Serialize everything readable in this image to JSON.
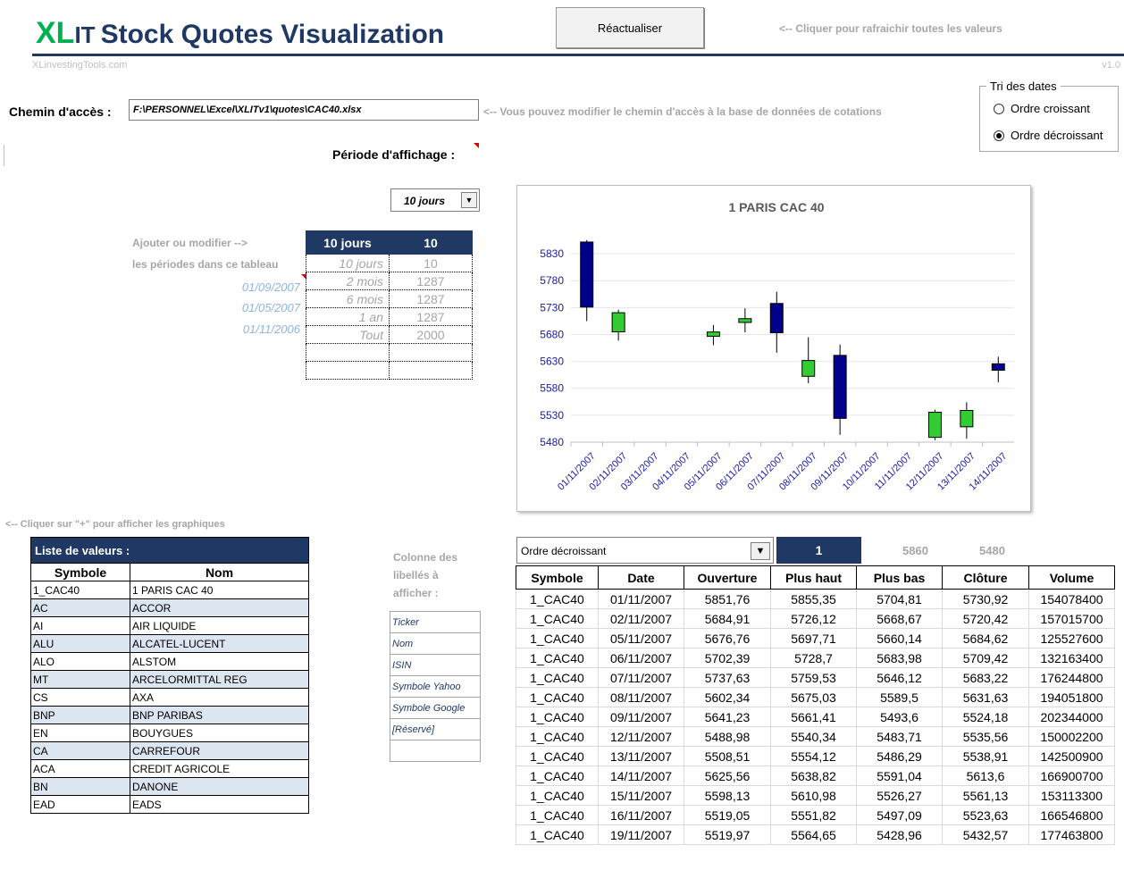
{
  "header": {
    "brand_xl": "XL",
    "brand_it": "IT",
    "brand_rest": "Stock Quotes Visualization",
    "site": "XLinvestingTools.com",
    "version": "v1.0",
    "refresh_label": "Réactualiser",
    "refresh_hint": "<-- Cliquer pour rafraichir toutes les valeurs"
  },
  "path": {
    "label": "Chemin d'accès :",
    "value": "F:\\PERSONNEL\\Excel\\XLITv1\\quotes\\CAC40.xlsx",
    "hint": "<-- Vous pouvez modifier le chemin d'accès à la base de données de cotations"
  },
  "sort": {
    "legend": "Tri des dates",
    "options": [
      "Ordre croissant",
      "Ordre décroissant"
    ],
    "selected": "Ordre décroissant"
  },
  "period": {
    "label": "Période d'affichage :",
    "selected": "10 jours",
    "hint_line1": "Ajouter ou modifier -->",
    "hint_line2": "les périodes dans ce tableau",
    "header": [
      "10 jours",
      "10"
    ],
    "rows": [
      {
        "date": "",
        "name": "10 jours",
        "value": "10"
      },
      {
        "date": "01/09/2007",
        "name": "2 mois",
        "value": "1287"
      },
      {
        "date": "01/05/2007",
        "name": "6 mois",
        "value": "1287"
      },
      {
        "date": "01/11/2006",
        "name": "1 an",
        "value": "1287"
      },
      {
        "date": "",
        "name": "Tout",
        "value": "2000"
      },
      {
        "date": "",
        "name": "",
        "value": ""
      },
      {
        "date": "",
        "name": "",
        "value": ""
      }
    ]
  },
  "chart_data": {
    "type": "candlestick",
    "title": "1 PARIS CAC 40",
    "ylim": [
      5480,
      5860
    ],
    "yticks": [
      5480,
      5530,
      5580,
      5630,
      5680,
      5730,
      5780,
      5830
    ],
    "categories": [
      "01/11/2007",
      "02/11/2007",
      "03/11/2007",
      "04/11/2007",
      "05/11/2007",
      "06/11/2007",
      "07/11/2007",
      "08/11/2007",
      "09/11/2007",
      "10/11/2007",
      "11/11/2007",
      "12/11/2007",
      "13/11/2007",
      "14/11/2007"
    ],
    "open": [
      5851.76,
      5684.91,
      null,
      null,
      5676.76,
      5702.39,
      5737.63,
      5602.34,
      5641.23,
      null,
      null,
      5488.98,
      5508.51,
      5625.56
    ],
    "high": [
      5855.35,
      5726.12,
      null,
      null,
      5697.71,
      5728.7,
      5759.53,
      5675.03,
      5661.41,
      null,
      null,
      5540.34,
      5554.12,
      5638.82
    ],
    "low": [
      5704.81,
      5668.67,
      null,
      null,
      5660.14,
      5683.98,
      5646.12,
      5589.5,
      5493.6,
      null,
      null,
      5483.71,
      5486.29,
      5591.04
    ],
    "close": [
      5730.92,
      5720.42,
      null,
      null,
      5684.62,
      5709.42,
      5683.22,
      5631.63,
      5524.18,
      null,
      null,
      5535.56,
      5538.91,
      5613.6
    ],
    "up_color": "#33cc33",
    "down_color": "#00008b",
    "grid": true
  },
  "list": {
    "plus_hint": "<-- Cliquer sur \"+\" pour afficher les graphiques",
    "title": "Liste de valeurs :",
    "col_symbol": "Symbole",
    "col_name": "Nom",
    "rows": [
      {
        "symbol": "1_CAC40",
        "name": "1 PARIS CAC 40"
      },
      {
        "symbol": "AC",
        "name": "ACCOR"
      },
      {
        "symbol": "AI",
        "name": "AIR LIQUIDE"
      },
      {
        "symbol": "ALU",
        "name": "ALCATEL-LUCENT"
      },
      {
        "symbol": "ALO",
        "name": "ALSTOM"
      },
      {
        "symbol": "MT",
        "name": "ARCELORMITTAL REG"
      },
      {
        "symbol": "CS",
        "name": "AXA"
      },
      {
        "symbol": "BNP",
        "name": "BNP PARIBAS"
      },
      {
        "symbol": "EN",
        "name": "BOUYGUES"
      },
      {
        "symbol": "CA",
        "name": "CARREFOUR"
      },
      {
        "symbol": "ACA",
        "name": "CREDIT AGRICOLE"
      },
      {
        "symbol": "BN",
        "name": "DANONE"
      },
      {
        "symbol": "EAD",
        "name": "EADS"
      }
    ]
  },
  "columns": {
    "label_line1": "Colonne des",
    "label_line2": "libellés à",
    "label_line3": "afficher :",
    "options": [
      "Ticker",
      "Nom",
      "ISIN",
      "Symbole Yahoo",
      "Symbole Google",
      "[Réservé]",
      ""
    ]
  },
  "quotes": {
    "order": "Ordre décroissant",
    "index": "1",
    "max": "5860",
    "min": "5480",
    "headers": [
      "Symbole",
      "Date",
      "Ouverture",
      "Plus haut",
      "Plus bas",
      "Clôture",
      "Volume"
    ],
    "rows": [
      [
        "1_CAC40",
        "01/11/2007",
        "5851,76",
        "5855,35",
        "5704,81",
        "5730,92",
        "154078400"
      ],
      [
        "1_CAC40",
        "02/11/2007",
        "5684,91",
        "5726,12",
        "5668,67",
        "5720,42",
        "157015700"
      ],
      [
        "1_CAC40",
        "05/11/2007",
        "5676,76",
        "5697,71",
        "5660,14",
        "5684,62",
        "125527600"
      ],
      [
        "1_CAC40",
        "06/11/2007",
        "5702,39",
        "5728,7",
        "5683,98",
        "5709,42",
        "132163400"
      ],
      [
        "1_CAC40",
        "07/11/2007",
        "5737,63",
        "5759,53",
        "5646,12",
        "5683,22",
        "176244800"
      ],
      [
        "1_CAC40",
        "08/11/2007",
        "5602,34",
        "5675,03",
        "5589,5",
        "5631,63",
        "194051800"
      ],
      [
        "1_CAC40",
        "09/11/2007",
        "5641,23",
        "5661,41",
        "5493,6",
        "5524,18",
        "202344000"
      ],
      [
        "1_CAC40",
        "12/11/2007",
        "5488,98",
        "5540,34",
        "5483,71",
        "5535,56",
        "150002200"
      ],
      [
        "1_CAC40",
        "13/11/2007",
        "5508,51",
        "5554,12",
        "5486,29",
        "5538,91",
        "142500900"
      ],
      [
        "1_CAC40",
        "14/11/2007",
        "5625,56",
        "5638,82",
        "5591,04",
        "5613,6",
        "166900700"
      ],
      [
        "1_CAC40",
        "15/11/2007",
        "5598,13",
        "5610,98",
        "5526,27",
        "5561,13",
        "153113300"
      ],
      [
        "1_CAC40",
        "16/11/2007",
        "5519,05",
        "5551,82",
        "5497,09",
        "5523,63",
        "166546800"
      ],
      [
        "1_CAC40",
        "19/11/2007",
        "5519,97",
        "5564,65",
        "5428,96",
        "5432,57",
        "177463800"
      ]
    ]
  }
}
